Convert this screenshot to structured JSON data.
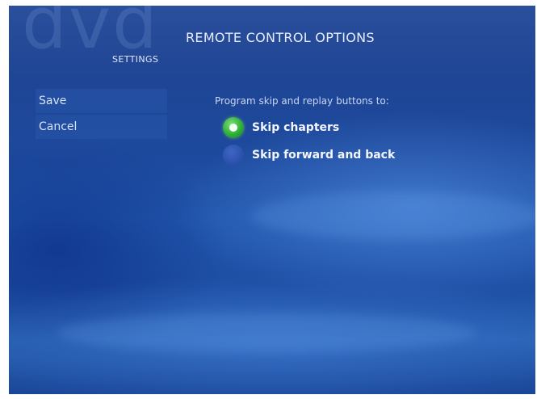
{
  "header": {
    "watermark": "dvd",
    "title": "REMOTE CONTROL OPTIONS",
    "section": "SETTINGS"
  },
  "sidebar": {
    "buttons": [
      {
        "label": "Save"
      },
      {
        "label": "Cancel"
      }
    ]
  },
  "main": {
    "prompt": "Program skip and replay buttons to:",
    "options": [
      {
        "label": "Skip chapters",
        "selected": true
      },
      {
        "label": "Skip forward and back",
        "selected": false
      }
    ]
  },
  "colors": {
    "selected_radio": "#2fae38",
    "unselected_radio": "#2c52ad",
    "background": "#1f4595"
  }
}
